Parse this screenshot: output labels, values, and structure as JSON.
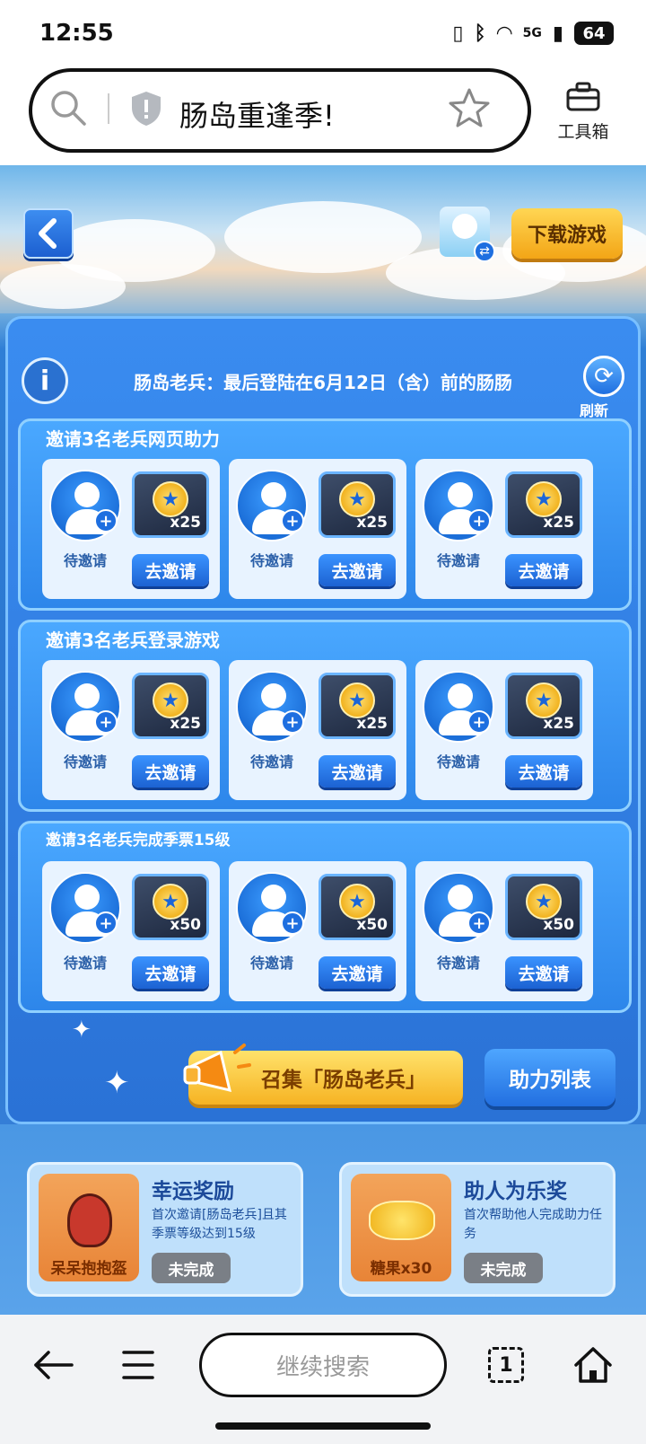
{
  "status": {
    "time": "12:55",
    "battery": "64",
    "network": "5G"
  },
  "address_bar": {
    "title": "肠岛重逢季!"
  },
  "toolbox": {
    "label": "工具箱"
  },
  "header": {
    "download_label": "下载游戏"
  },
  "panel": {
    "note": "肠岛老兵：最后登陆在6月12日（含）前的肠肠",
    "refresh_label": "刷新"
  },
  "sections": [
    {
      "title": "邀请3名老兵网页助力",
      "cards": [
        {
          "status": "待邀请",
          "qty": "x25",
          "button": "去邀请"
        },
        {
          "status": "待邀请",
          "qty": "x25",
          "button": "去邀请"
        },
        {
          "status": "待邀请",
          "qty": "x25",
          "button": "去邀请"
        }
      ]
    },
    {
      "title": "邀请3名老兵登录游戏",
      "cards": [
        {
          "status": "待邀请",
          "qty": "x25",
          "button": "去邀请"
        },
        {
          "status": "待邀请",
          "qty": "x25",
          "button": "去邀请"
        },
        {
          "status": "待邀请",
          "qty": "x25",
          "button": "去邀请"
        }
      ]
    },
    {
      "title": "邀请3名老兵完成季票15级",
      "cards": [
        {
          "status": "待邀请",
          "qty": "x50",
          "button": "去邀请"
        },
        {
          "status": "待邀请",
          "qty": "x50",
          "button": "去邀请"
        },
        {
          "status": "待邀请",
          "qty": "x50",
          "button": "去邀请"
        }
      ]
    }
  ],
  "actions": {
    "gather_label": "召集「肠岛老兵」",
    "help_list_label": "助力列表"
  },
  "rewards": [
    {
      "title": "幸运奖励",
      "desc": "首次邀请[肠岛老兵]且其季票等级达到15级",
      "item_label": "呆呆抱抱盔",
      "status": "未完成"
    },
    {
      "title": "助人为乐奖",
      "desc": "首次帮助他人完成助力任务",
      "item_label": "糖果x30",
      "status": "未完成"
    }
  ],
  "bottom_nav": {
    "search_placeholder": "继续搜索",
    "tabs_count": "1"
  },
  "colors": {
    "primary_blue": "#2a74cf",
    "gold": "#f6b323",
    "gray_status": "#7a7f86"
  }
}
